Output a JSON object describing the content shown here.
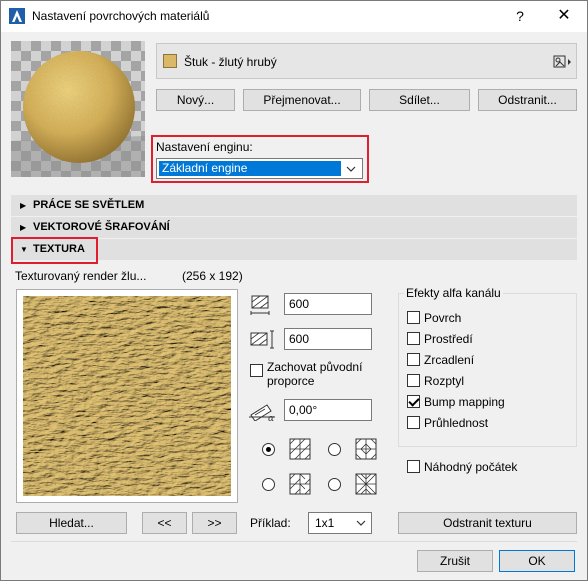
{
  "window": {
    "title": "Nastavení povrchových materiálů",
    "help_label": "?",
    "close_label": "✕"
  },
  "material": {
    "name": "Štuk - žlutý hrubý",
    "swatch_color": "#dbb867"
  },
  "buttons": {
    "new": "Nový...",
    "rename": "Přejmenovat...",
    "share": "Sdílet...",
    "delete": "Odstranit..."
  },
  "engine": {
    "label": "Nastavení enginu:",
    "value": "Základní engine"
  },
  "sections": [
    {
      "label": "PRÁCE SE SVĚTLEM",
      "expanded": false
    },
    {
      "label": "VEKTOROVÉ ŠRAFOVÁNÍ",
      "expanded": false
    },
    {
      "label": "TEXTURA",
      "expanded": true
    }
  ],
  "texture": {
    "name": "Texturovaný render žlu...",
    "size": "(256 x 192)",
    "width_value": "600",
    "height_value": "600",
    "keep_ratio_label": "Zachovat původní proporce",
    "keep_ratio_checked": false,
    "angle_value": "0,00°",
    "browse_button": "Hledat...",
    "prev_button": "<<",
    "next_button": ">>",
    "example_label": "Příklad:",
    "example_value": "1x1",
    "remove_button": "Odstranit texturu"
  },
  "alpha_effects": {
    "title": "Efekty alfa kanálu",
    "items": [
      {
        "label": "Povrch",
        "checked": false
      },
      {
        "label": "Prostředí",
        "checked": false
      },
      {
        "label": "Zrcadlení",
        "checked": false
      },
      {
        "label": "Rozptyl",
        "checked": false
      },
      {
        "label": "Bump mapping",
        "checked": true
      },
      {
        "label": "Průhlednost",
        "checked": false
      }
    ],
    "random_origin_label": "Náhodný počátek",
    "random_origin_checked": false
  },
  "dialog": {
    "cancel": "Zrušit",
    "ok": "OK"
  },
  "colors": {
    "accent": "#0078d7",
    "highlight": "#e01e2e",
    "texture": "#d8b764"
  }
}
